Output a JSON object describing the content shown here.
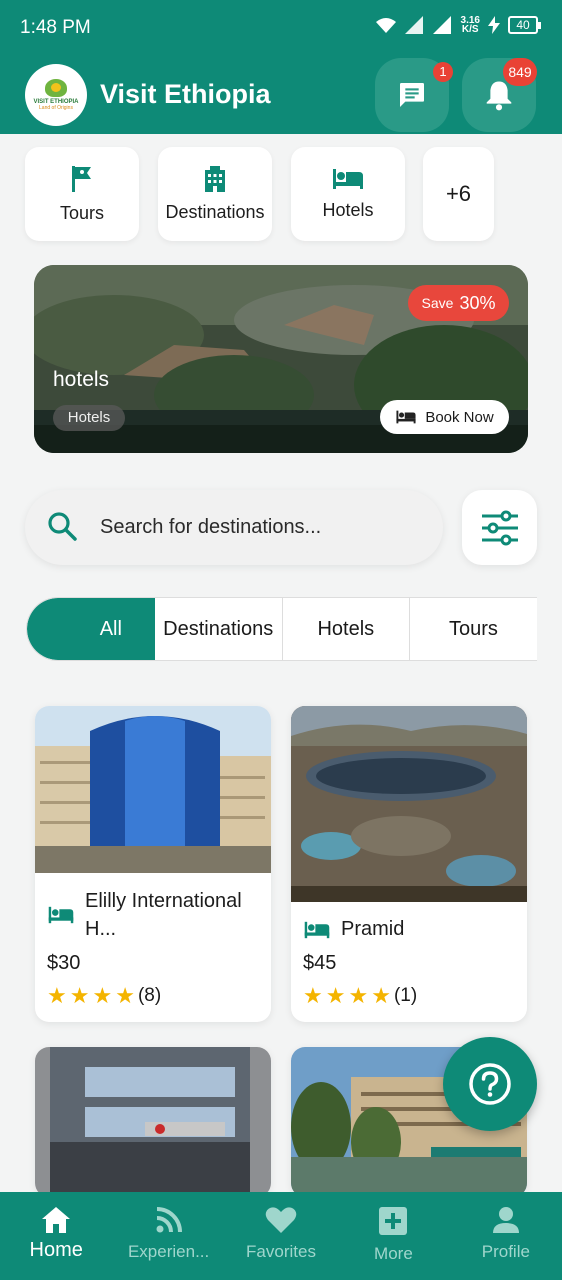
{
  "status_bar": {
    "time": "1:48 PM",
    "net_speed": "3.16",
    "net_unit": "K/S",
    "battery": "40"
  },
  "header": {
    "title": "Visit Ethiopia",
    "logo_line1": "VISIT ETHIOPIA",
    "logo_line2": "Land of Origins",
    "chat_badge": "1",
    "bell_badge": "849"
  },
  "categories": [
    {
      "label": "Tours",
      "icon": "flag-icon"
    },
    {
      "label": "Destinations",
      "icon": "building-icon"
    },
    {
      "label": "Hotels",
      "icon": "bed-icon"
    },
    {
      "label": "+6"
    }
  ],
  "banner": {
    "save_label": "Save",
    "save_value": "30%",
    "title": "hotels",
    "tag": "Hotels",
    "book_label": "Book Now"
  },
  "search": {
    "placeholder": "Search for destinations..."
  },
  "tabs": [
    "All",
    "Destinations",
    "Hotels",
    "Tours"
  ],
  "listings": [
    {
      "name": "Elilly International H...",
      "price": "$30",
      "rating": 4,
      "reviews": "(8)"
    },
    {
      "name": "Pramid",
      "price": "$45",
      "rating": 4,
      "reviews": "(1)"
    }
  ],
  "bottom_nav": [
    {
      "label": "Home",
      "icon": "home-icon",
      "active": true
    },
    {
      "label": "Experien...",
      "icon": "feed-icon"
    },
    {
      "label": "Favorites",
      "icon": "heart-icon"
    },
    {
      "label": "More",
      "icon": "plus-box-icon"
    },
    {
      "label": "Profile",
      "icon": "person-icon"
    }
  ],
  "colors": {
    "primary": "#0e8a77",
    "badge": "#e94235",
    "star": "#f4b400"
  }
}
